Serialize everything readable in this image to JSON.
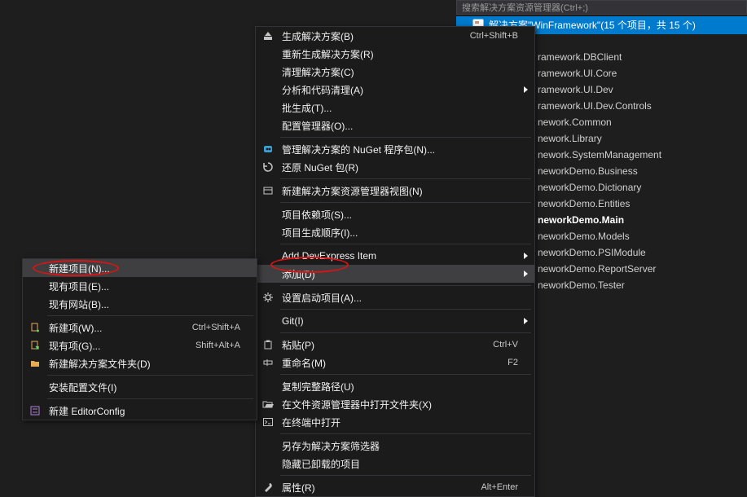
{
  "solutionExplorer": {
    "searchPlaceholder": "搜索解决方案资源管理器(Ctrl+;)",
    "selectedNode": "解决方案\"WinFramework\"(15 个项目，共 15 个)",
    "items": [
      {
        "label": "ramework.DBClient",
        "bold": false
      },
      {
        "label": "ramework.UI.Core",
        "bold": false
      },
      {
        "label": "ramework.UI.Dev",
        "bold": false
      },
      {
        "label": "ramework.UI.Dev.Controls",
        "bold": false
      },
      {
        "label": "nework.Common",
        "bold": false
      },
      {
        "label": "nework.Library",
        "bold": false
      },
      {
        "label": "nework.SystemManagement",
        "bold": false
      },
      {
        "label": "neworkDemo.Business",
        "bold": false
      },
      {
        "label": "neworkDemo.Dictionary",
        "bold": false
      },
      {
        "label": "neworkDemo.Entities",
        "bold": false
      },
      {
        "label": "neworkDemo.Main",
        "bold": true
      },
      {
        "label": "neworkDemo.Models",
        "bold": false
      },
      {
        "label": "neworkDemo.PSIModule",
        "bold": false
      },
      {
        "label": "neworkDemo.ReportServer",
        "bold": false
      },
      {
        "label": "neworkDemo.Tester",
        "bold": false
      }
    ]
  },
  "mainMenu": {
    "groups": [
      [
        {
          "icon": "build-icon",
          "label": "生成解决方案(B)",
          "shortcut": "Ctrl+Shift+B"
        },
        {
          "icon": "",
          "label": "重新生成解决方案(R)",
          "shortcut": ""
        },
        {
          "icon": "",
          "label": "清理解决方案(C)",
          "shortcut": ""
        },
        {
          "icon": "",
          "label": "分析和代码清理(A)",
          "shortcut": "",
          "arrow": true
        },
        {
          "icon": "",
          "label": "批生成(T)...",
          "shortcut": ""
        },
        {
          "icon": "",
          "label": "配置管理器(O)...",
          "shortcut": ""
        }
      ],
      [
        {
          "icon": "nuget-icon",
          "label": "管理解决方案的 NuGet 程序包(N)...",
          "shortcut": ""
        },
        {
          "icon": "restore-icon",
          "label": "还原 NuGet 包(R)",
          "shortcut": ""
        }
      ],
      [
        {
          "icon": "newview-icon",
          "label": "新建解决方案资源管理器视图(N)",
          "shortcut": ""
        }
      ],
      [
        {
          "icon": "",
          "label": "项目依赖项(S)...",
          "shortcut": ""
        },
        {
          "icon": "",
          "label": "项目生成顺序(I)...",
          "shortcut": ""
        }
      ],
      [
        {
          "icon": "",
          "label": "Add DevExpress Item",
          "shortcut": "",
          "arrow": true
        },
        {
          "icon": "",
          "label": "添加(D)",
          "shortcut": "",
          "arrow": true,
          "highlight": true
        }
      ],
      [
        {
          "icon": "gear-icon",
          "label": "设置启动项目(A)...",
          "shortcut": ""
        }
      ],
      [
        {
          "icon": "",
          "label": "Git(I)",
          "shortcut": "",
          "arrow": true
        }
      ],
      [
        {
          "icon": "paste-icon",
          "label": "粘贴(P)",
          "shortcut": "Ctrl+V"
        },
        {
          "icon": "rename-icon",
          "label": "重命名(M)",
          "shortcut": "F2"
        }
      ],
      [
        {
          "icon": "",
          "label": "复制完整路径(U)",
          "shortcut": ""
        },
        {
          "icon": "folder-open-icon",
          "label": "在文件资源管理器中打开文件夹(X)",
          "shortcut": ""
        },
        {
          "icon": "terminal-icon",
          "label": "在终端中打开",
          "shortcut": ""
        }
      ],
      [
        {
          "icon": "",
          "label": "另存为解决方案筛选器",
          "shortcut": ""
        },
        {
          "icon": "",
          "label": "隐藏已卸载的项目",
          "shortcut": ""
        }
      ],
      [
        {
          "icon": "wrench-icon",
          "label": "属性(R)",
          "shortcut": "Alt+Enter"
        }
      ]
    ]
  },
  "subMenu": {
    "groups": [
      [
        {
          "icon": "",
          "label": "新建项目(N)...",
          "shortcut": "",
          "highlight": true
        },
        {
          "icon": "",
          "label": "现有项目(E)...",
          "shortcut": ""
        },
        {
          "icon": "",
          "label": "现有网站(B)...",
          "shortcut": ""
        }
      ],
      [
        {
          "icon": "newitem-icon",
          "label": "新建项(W)...",
          "shortcut": "Ctrl+Shift+A"
        },
        {
          "icon": "existitem-icon",
          "label": "现有项(G)...",
          "shortcut": "Shift+Alt+A"
        },
        {
          "icon": "newfolder-icon",
          "label": "新建解决方案文件夹(D)",
          "shortcut": ""
        }
      ],
      [
        {
          "icon": "",
          "label": "安装配置文件(I)",
          "shortcut": ""
        }
      ],
      [
        {
          "icon": "editorconfig-icon",
          "label": "新建 EditorConfig",
          "shortcut": ""
        }
      ]
    ]
  }
}
